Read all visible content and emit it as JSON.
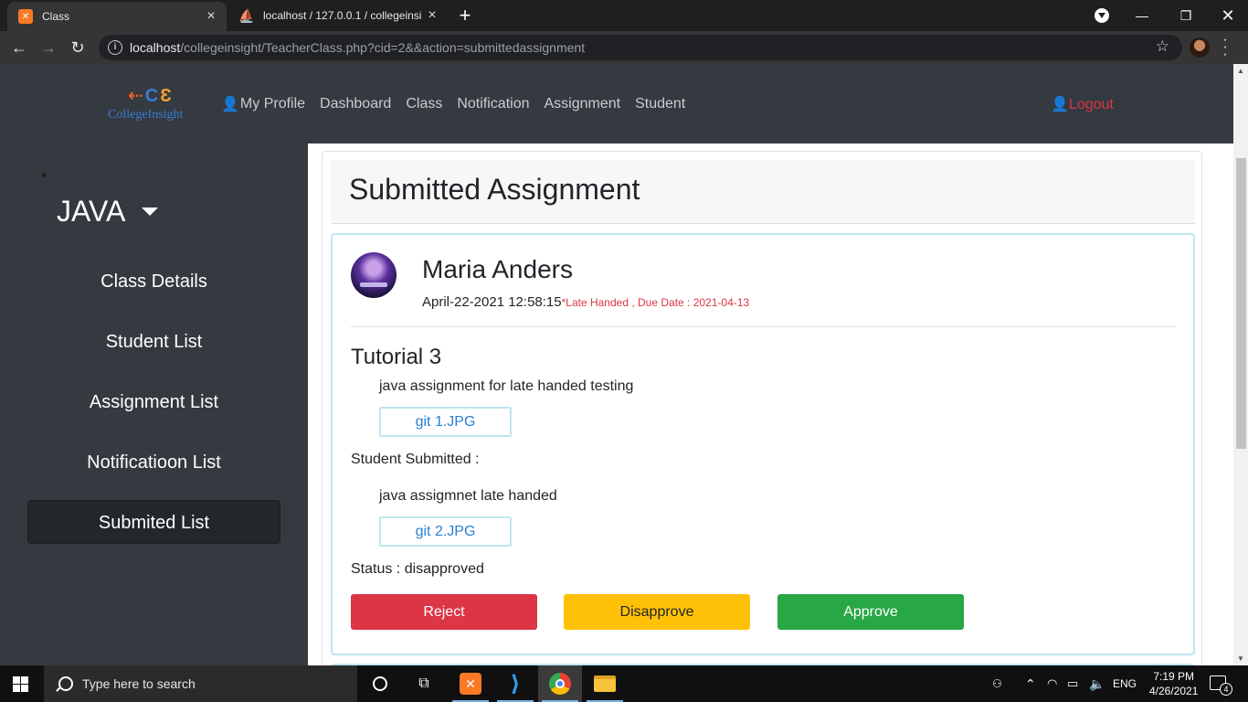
{
  "browser": {
    "tabs": [
      {
        "title": "Class",
        "active": true
      },
      {
        "title": "localhost / 127.0.0.1 / collegeinsi",
        "active": false
      }
    ],
    "new_tab": "+",
    "url_host": "localhost",
    "url_path": "/collegeinsight/TeacherClass.php?cid=2&&action=submittedassignment"
  },
  "site": {
    "logo_text": "CollegeInsight",
    "nav": [
      "My Profile",
      "Dashboard",
      "Class",
      "Notification",
      "Assignment",
      "Student"
    ],
    "logout": "Logout"
  },
  "sidebar": {
    "title": "JAVA",
    "items": [
      {
        "label": "Class Details",
        "active": false
      },
      {
        "label": "Student List",
        "active": false
      },
      {
        "label": "Assignment List",
        "active": false
      },
      {
        "label": "Notificatioon List",
        "active": false
      },
      {
        "label": "Submited List",
        "active": true
      }
    ]
  },
  "main": {
    "heading": "Submitted Assignment",
    "submission": {
      "student_name": "Maria Anders",
      "submitted_at": "April-22-2021 12:58:15",
      "late_note": "*Late Handed , Due Date : 2021-04-13",
      "assignment_title": "Tutorial 3",
      "assignment_desc": "java assignment for late handed testing",
      "assignment_file": "git 1.JPG",
      "student_label": "Student Submitted :",
      "student_desc": "java assigmnet late handed",
      "student_file": "git 2.JPG",
      "status": "Status : disapproved",
      "buttons": {
        "reject": "Reject",
        "disapprove": "Disapprove",
        "approve": "Approve"
      }
    }
  },
  "taskbar": {
    "search_placeholder": "Type here to search",
    "language": "ENG",
    "time": "7:19 PM",
    "date": "4/26/2021",
    "notification_count": "4"
  },
  "colors": {
    "sidebar_bg": "#343a40",
    "danger": "#dc3545",
    "warning": "#ffc107",
    "success": "#28a745",
    "link": "#2a7fd4"
  }
}
